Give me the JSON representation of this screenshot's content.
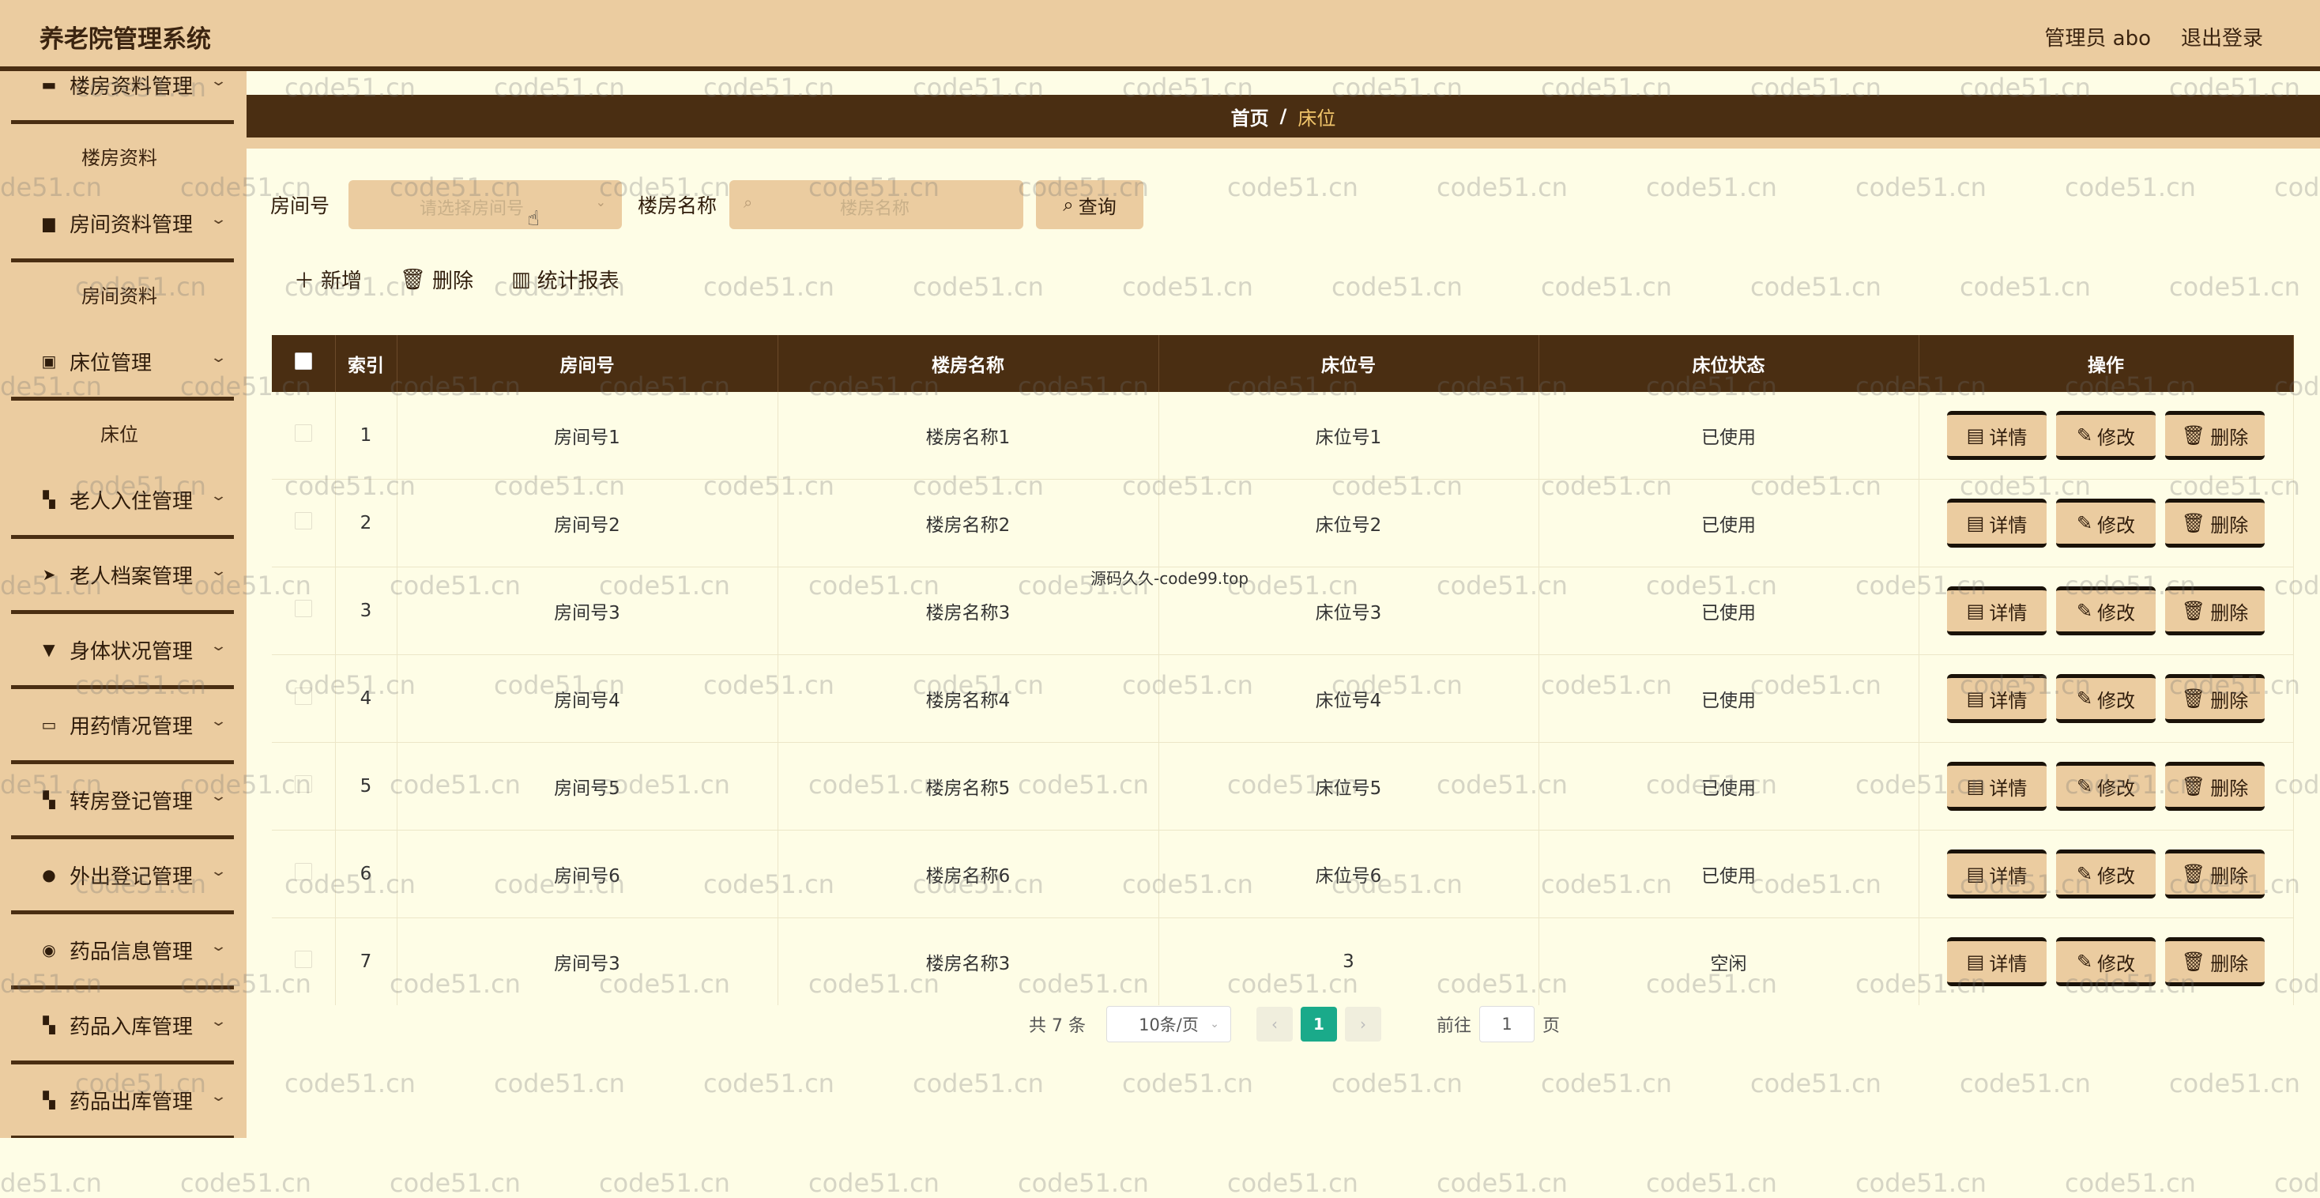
{
  "header": {
    "title": "养老院管理系统",
    "user": "管理员 abo",
    "logout": "退出登录"
  },
  "sidebar": {
    "groups": [
      {
        "label": "楼房资料管理",
        "icon": "comment-icon",
        "sub": "楼房资料"
      },
      {
        "label": "房间资料管理",
        "icon": "printer-icon",
        "sub": "房间资料"
      },
      {
        "label": "床位管理",
        "icon": "calendar-icon",
        "sub": "床位"
      },
      {
        "label": "老人入住管理",
        "icon": "grid-icon"
      },
      {
        "label": "老人档案管理",
        "icon": "send-icon"
      },
      {
        "label": "身体状况管理",
        "icon": "pin-icon"
      },
      {
        "label": "用药情况管理",
        "icon": "briefcase-icon"
      },
      {
        "label": "转房登记管理",
        "icon": "grid-icon"
      },
      {
        "label": "外出登记管理",
        "icon": "user-icon"
      },
      {
        "label": "药品信息管理",
        "icon": "location-icon"
      },
      {
        "label": "药品入库管理",
        "icon": "grid-icon"
      },
      {
        "label": "药品出库管理",
        "icon": "grid-icon"
      }
    ]
  },
  "breadcrumb": {
    "home": "首页",
    "sep": "/",
    "current": "床位"
  },
  "search": {
    "room_label": "房间号",
    "room_placeholder": "请选择房间号",
    "building_label": "楼房名称",
    "building_placeholder": "楼房名称",
    "query_button": "查询"
  },
  "toolbar": {
    "add": "新增",
    "delete": "删除",
    "report": "统计报表"
  },
  "table": {
    "columns": [
      "索引",
      "房间号",
      "楼房名称",
      "床位号",
      "床位状态",
      "操作"
    ],
    "rows": [
      {
        "idx": "1",
        "room": "房间号1",
        "building": "楼房名称1",
        "bed": "床位号1",
        "status": "已使用"
      },
      {
        "idx": "2",
        "room": "房间号2",
        "building": "楼房名称2",
        "bed": "床位号2",
        "status": "已使用"
      },
      {
        "idx": "3",
        "room": "房间号3",
        "building": "楼房名称3",
        "bed": "床位号3",
        "status": "已使用"
      },
      {
        "idx": "4",
        "room": "房间号4",
        "building": "楼房名称4",
        "bed": "床位号4",
        "status": "已使用"
      },
      {
        "idx": "5",
        "room": "房间号5",
        "building": "楼房名称5",
        "bed": "床位号5",
        "status": "已使用"
      },
      {
        "idx": "6",
        "room": "房间号6",
        "building": "楼房名称6",
        "bed": "床位号6",
        "status": "已使用"
      },
      {
        "idx": "7",
        "room": "房间号3",
        "building": "楼房名称3",
        "bed": "3",
        "status": "空闲"
      }
    ],
    "actions": {
      "detail": "详情",
      "edit": "修改",
      "delete": "删除"
    }
  },
  "pagination": {
    "total": "共 7 条",
    "page_size": "10条/页",
    "current": "1",
    "goto_label": "前往",
    "goto_value": "1",
    "page_unit": "页"
  },
  "watermark": {
    "text": "code51.cn",
    "center": "源码久久-code99.top"
  }
}
